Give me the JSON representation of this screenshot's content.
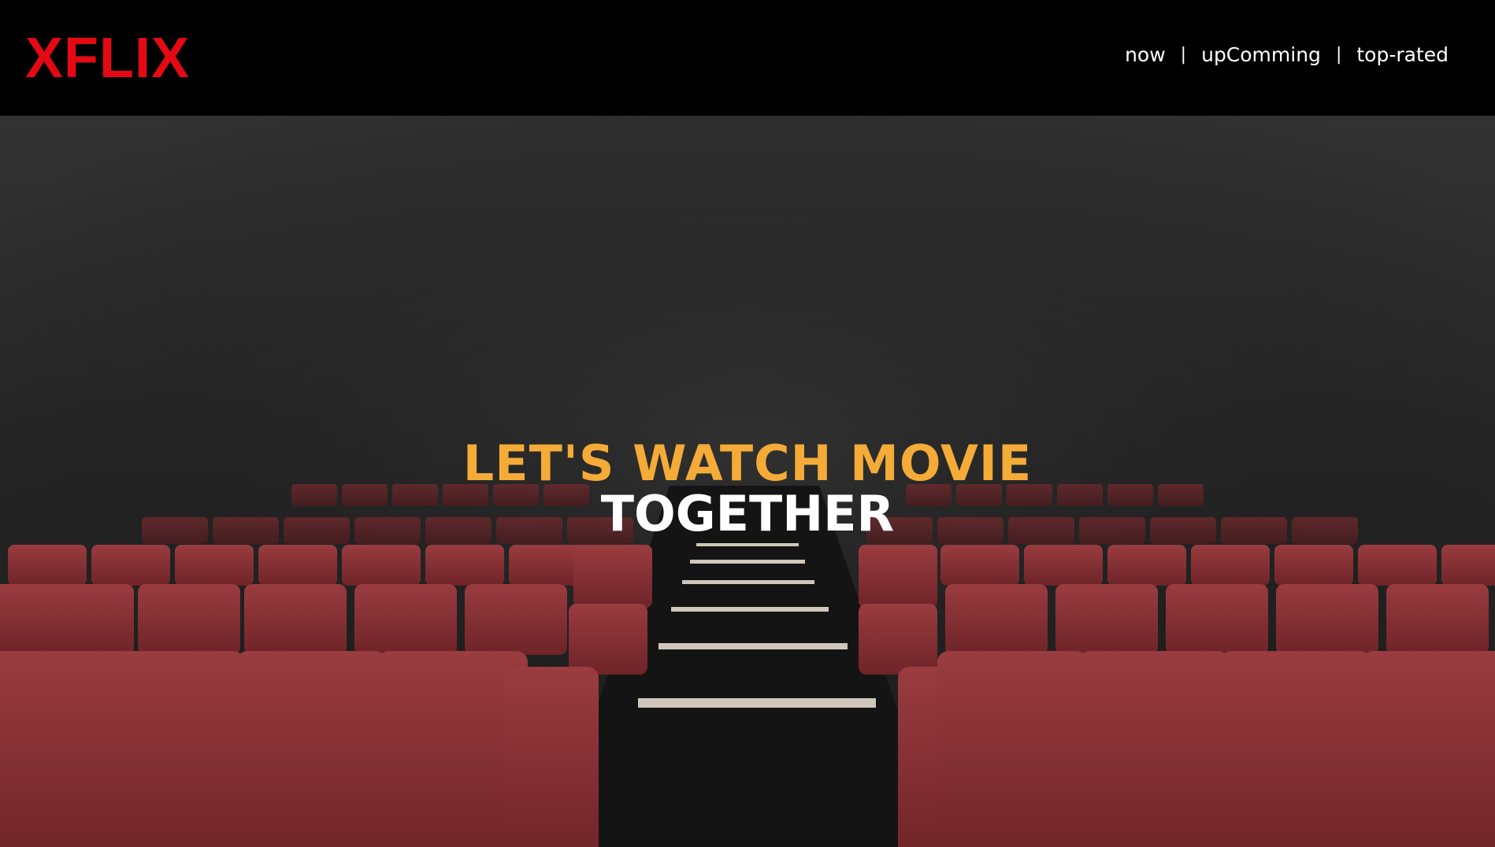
{
  "brand": {
    "logo_text": "XFLIX",
    "color": "#e50914"
  },
  "nav": {
    "items": [
      {
        "label": "now"
      },
      {
        "label": "upComming"
      },
      {
        "label": "top-rated"
      }
    ],
    "separator": "|"
  },
  "hero": {
    "headline_line1": "LET'S WATCH MOVIE",
    "headline_line2": "TOGETHER",
    "accent_color": "#f4ab38",
    "background": "cinema-seats-photo"
  }
}
